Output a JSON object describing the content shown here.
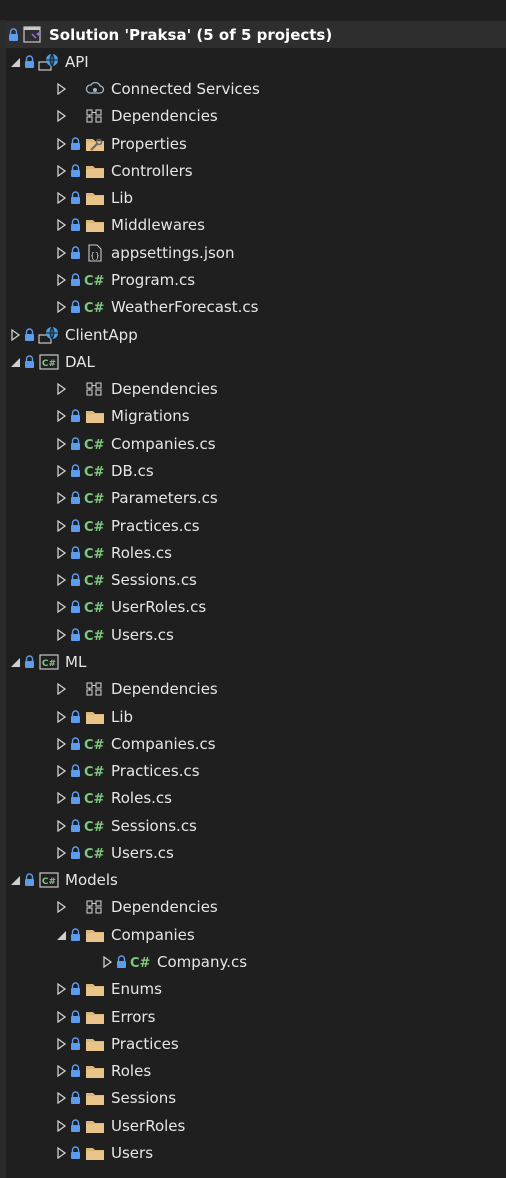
{
  "solution": {
    "label": "Solution 'Praksa' (5 of 5 projects)"
  },
  "rows": [
    {
      "label": "Solution 'Praksa' (5 of 5 projects)",
      "depth": 0,
      "twisty": "none",
      "lock": true,
      "icon": "solution-icon",
      "selected": true
    },
    {
      "label": "API",
      "depth": 0,
      "twisty": "expanded",
      "lock": true,
      "icon": "web-project-icon"
    },
    {
      "label": "Connected Services",
      "depth": 1,
      "twisty": "collapsed",
      "lock": false,
      "icon": "connected-services-icon"
    },
    {
      "label": "Dependencies",
      "depth": 1,
      "twisty": "collapsed",
      "lock": false,
      "icon": "dependencies-icon"
    },
    {
      "label": "Properties",
      "depth": 1,
      "twisty": "collapsed",
      "lock": true,
      "icon": "properties-folder-icon"
    },
    {
      "label": "Controllers",
      "depth": 1,
      "twisty": "collapsed",
      "lock": true,
      "icon": "folder-icon"
    },
    {
      "label": "Lib",
      "depth": 1,
      "twisty": "collapsed",
      "lock": true,
      "icon": "folder-icon"
    },
    {
      "label": "Middlewares",
      "depth": 1,
      "twisty": "collapsed",
      "lock": true,
      "icon": "folder-icon"
    },
    {
      "label": "appsettings.json",
      "depth": 1,
      "twisty": "collapsed",
      "lock": true,
      "icon": "json-file-icon"
    },
    {
      "label": "Program.cs",
      "depth": 1,
      "twisty": "collapsed",
      "lock": true,
      "icon": "csharp-file-icon"
    },
    {
      "label": "WeatherForecast.cs",
      "depth": 1,
      "twisty": "collapsed",
      "lock": true,
      "icon": "csharp-file-icon"
    },
    {
      "label": "ClientApp",
      "depth": 0,
      "twisty": "collapsed",
      "lock": true,
      "icon": "web-project-icon"
    },
    {
      "label": "DAL",
      "depth": 0,
      "twisty": "expanded",
      "lock": true,
      "icon": "csharp-project-icon"
    },
    {
      "label": "Dependencies",
      "depth": 1,
      "twisty": "collapsed",
      "lock": false,
      "icon": "dependencies-icon"
    },
    {
      "label": "Migrations",
      "depth": 1,
      "twisty": "collapsed",
      "lock": true,
      "icon": "folder-icon"
    },
    {
      "label": "Companies.cs",
      "depth": 1,
      "twisty": "collapsed",
      "lock": true,
      "icon": "csharp-file-icon"
    },
    {
      "label": "DB.cs",
      "depth": 1,
      "twisty": "collapsed",
      "lock": true,
      "icon": "csharp-file-icon"
    },
    {
      "label": "Parameters.cs",
      "depth": 1,
      "twisty": "collapsed",
      "lock": true,
      "icon": "csharp-file-icon"
    },
    {
      "label": "Practices.cs",
      "depth": 1,
      "twisty": "collapsed",
      "lock": true,
      "icon": "csharp-file-icon"
    },
    {
      "label": "Roles.cs",
      "depth": 1,
      "twisty": "collapsed",
      "lock": true,
      "icon": "csharp-file-icon"
    },
    {
      "label": "Sessions.cs",
      "depth": 1,
      "twisty": "collapsed",
      "lock": true,
      "icon": "csharp-file-icon"
    },
    {
      "label": "UserRoles.cs",
      "depth": 1,
      "twisty": "collapsed",
      "lock": true,
      "icon": "csharp-file-icon"
    },
    {
      "label": "Users.cs",
      "depth": 1,
      "twisty": "collapsed",
      "lock": true,
      "icon": "csharp-file-icon"
    },
    {
      "label": "ML",
      "depth": 0,
      "twisty": "expanded",
      "lock": true,
      "icon": "csharp-project-icon"
    },
    {
      "label": "Dependencies",
      "depth": 1,
      "twisty": "collapsed",
      "lock": false,
      "icon": "dependencies-icon"
    },
    {
      "label": "Lib",
      "depth": 1,
      "twisty": "collapsed",
      "lock": true,
      "icon": "folder-icon"
    },
    {
      "label": "Companies.cs",
      "depth": 1,
      "twisty": "collapsed",
      "lock": true,
      "icon": "csharp-file-icon"
    },
    {
      "label": "Practices.cs",
      "depth": 1,
      "twisty": "collapsed",
      "lock": true,
      "icon": "csharp-file-icon"
    },
    {
      "label": "Roles.cs",
      "depth": 1,
      "twisty": "collapsed",
      "lock": true,
      "icon": "csharp-file-icon"
    },
    {
      "label": "Sessions.cs",
      "depth": 1,
      "twisty": "collapsed",
      "lock": true,
      "icon": "csharp-file-icon"
    },
    {
      "label": "Users.cs",
      "depth": 1,
      "twisty": "collapsed",
      "lock": true,
      "icon": "csharp-file-icon"
    },
    {
      "label": "Models",
      "depth": 0,
      "twisty": "expanded",
      "lock": true,
      "icon": "csharp-project-icon"
    },
    {
      "label": "Dependencies",
      "depth": 1,
      "twisty": "collapsed",
      "lock": false,
      "icon": "dependencies-icon"
    },
    {
      "label": "Companies",
      "depth": 1,
      "twisty": "expanded",
      "lock": true,
      "icon": "folder-icon"
    },
    {
      "label": "Company.cs",
      "depth": 2,
      "twisty": "collapsed",
      "lock": true,
      "icon": "csharp-file-icon"
    },
    {
      "label": "Enums",
      "depth": 1,
      "twisty": "collapsed",
      "lock": true,
      "icon": "folder-icon"
    },
    {
      "label": "Errors",
      "depth": 1,
      "twisty": "collapsed",
      "lock": true,
      "icon": "folder-icon"
    },
    {
      "label": "Practices",
      "depth": 1,
      "twisty": "collapsed",
      "lock": true,
      "icon": "folder-icon"
    },
    {
      "label": "Roles",
      "depth": 1,
      "twisty": "collapsed",
      "lock": true,
      "icon": "folder-icon"
    },
    {
      "label": "Sessions",
      "depth": 1,
      "twisty": "collapsed",
      "lock": true,
      "icon": "folder-icon"
    },
    {
      "label": "UserRoles",
      "depth": 1,
      "twisty": "collapsed",
      "lock": true,
      "icon": "folder-icon"
    },
    {
      "label": "Users",
      "depth": 1,
      "twisty": "collapsed",
      "lock": true,
      "icon": "folder-icon"
    }
  ],
  "colors": {
    "background": "#1f1f1f",
    "text": "#e6e6e6",
    "folder": "#dcb67a",
    "lock": "#5d9cec",
    "csharp": "#7ec77e",
    "web": "#4aa3e8",
    "twisty": "#cfcfcf",
    "selection": "#2e2e2e"
  }
}
